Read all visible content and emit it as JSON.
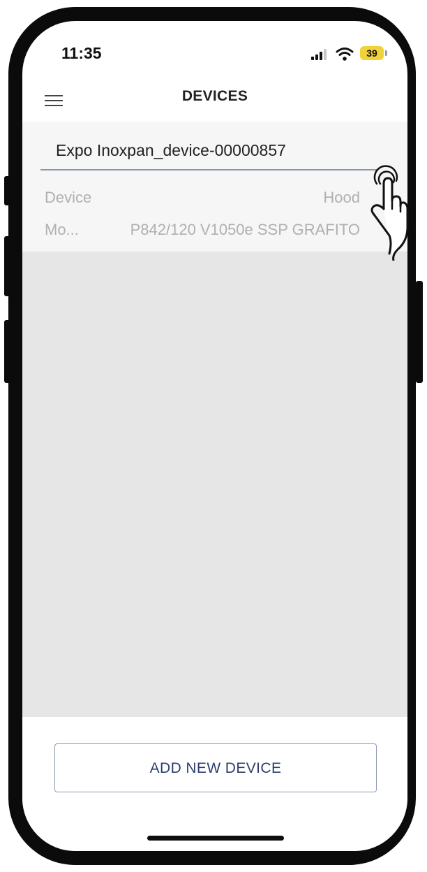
{
  "status_bar": {
    "time": "11:35",
    "battery_level": "39",
    "battery_color": "#f2d23a",
    "icons": [
      "cellular-signal-icon",
      "wifi-icon",
      "battery-icon"
    ]
  },
  "nav": {
    "menu_icon": "hamburger-menu-icon",
    "title": "DEVICES"
  },
  "device": {
    "name": "Expo Inoxpan_device-00000857",
    "rows": [
      {
        "label": "Device",
        "value": "Hood"
      },
      {
        "label": "Mo...",
        "value": "P842/120 V1050e SSP GRAFITO"
      }
    ]
  },
  "footer": {
    "add_button_label": "ADD NEW DEVICE",
    "accent_color": "#2d3f6c"
  },
  "annotation": {
    "icon": "tap-gesture-hand-icon"
  }
}
